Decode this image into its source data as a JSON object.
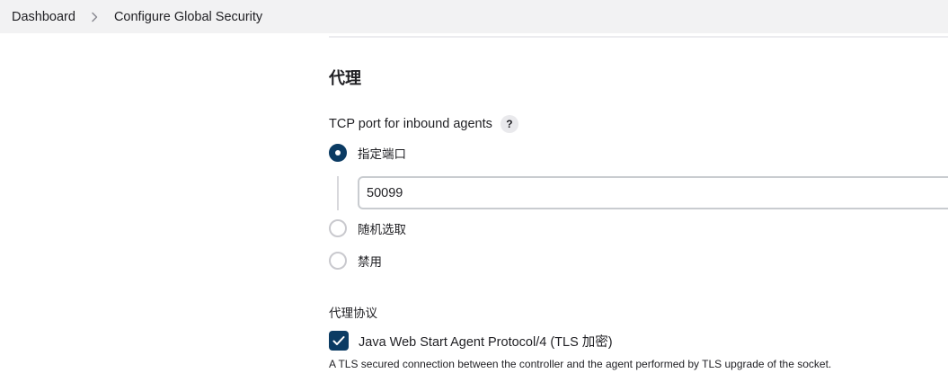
{
  "breadcrumb": {
    "items": [
      "Dashboard",
      "Configure Global Security"
    ]
  },
  "section": {
    "title": "代理"
  },
  "tcp_port": {
    "label": "TCP port for inbound agents",
    "help": "?",
    "options": [
      {
        "label": "指定端口",
        "selected": true
      },
      {
        "label": "随机选取",
        "selected": false
      },
      {
        "label": "禁用",
        "selected": false
      }
    ],
    "port_value": "50099"
  },
  "protocols": {
    "title": "代理协议",
    "items": [
      {
        "label": "Java Web Start Agent Protocol/4 (TLS 加密)",
        "checked": true,
        "description": "A TLS secured connection between the controller and the agent performed by TLS upgrade of the socket."
      }
    ]
  },
  "colors": {
    "accent": "#0b3b63",
    "breadcrumb_bg": "#f2f2f3"
  }
}
